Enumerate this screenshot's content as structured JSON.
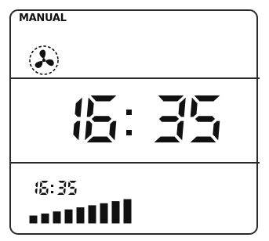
{
  "mode": {
    "label": "MANUAL"
  },
  "fan": {
    "icon": "fan-icon"
  },
  "time": {
    "hours": "16",
    "separator": ":",
    "minutes": "35"
  },
  "small_time": {
    "hours": "16",
    "separator": ":",
    "minutes": "35"
  },
  "signal": {
    "icon": "signal-strength-icon",
    "filled_bars": 9,
    "total_bars": 9
  },
  "colors": {
    "segment": "#111111",
    "frame": "#2a2a2a",
    "background": "#ffffff"
  }
}
